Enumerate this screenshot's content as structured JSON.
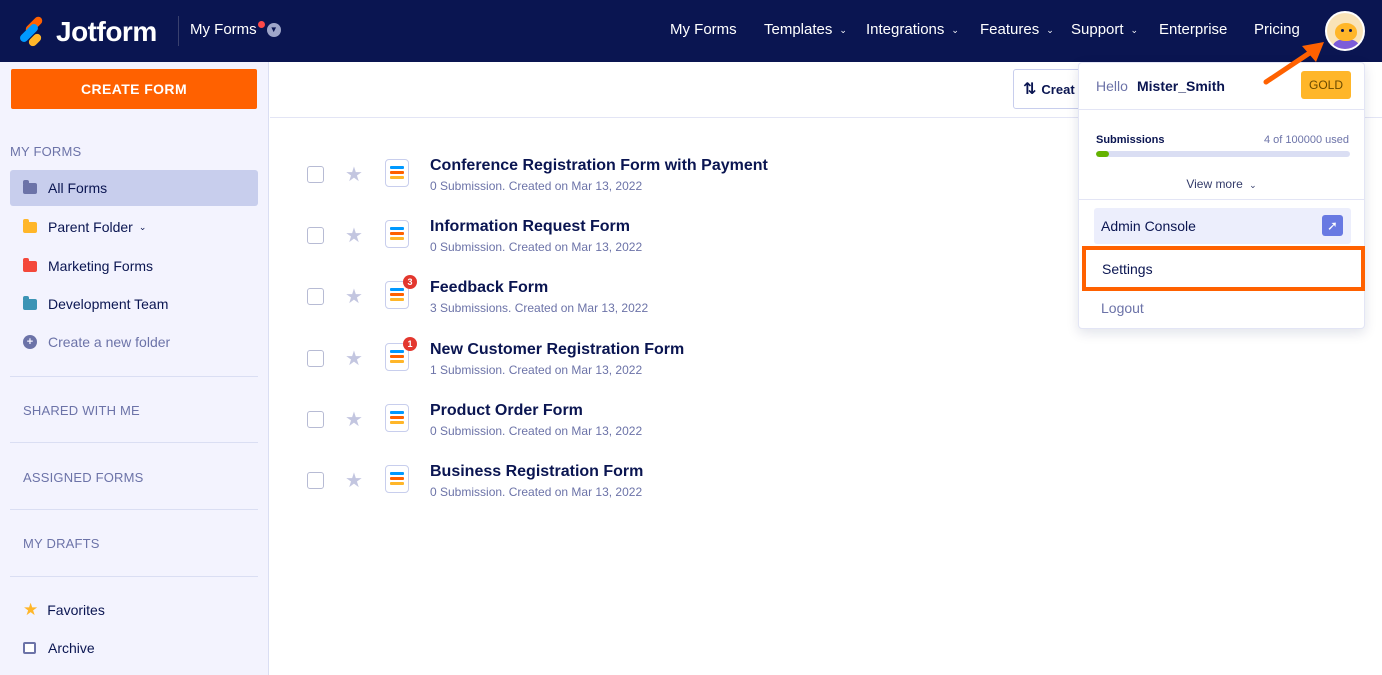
{
  "app": {
    "brand": "Jotform",
    "section": "My Forms"
  },
  "nav": {
    "items": [
      {
        "label": "My Forms",
        "has_menu": false
      },
      {
        "label": "Templates",
        "has_menu": true
      },
      {
        "label": "Integrations",
        "has_menu": true
      },
      {
        "label": "Features",
        "has_menu": true
      },
      {
        "label": "Support",
        "has_menu": true
      },
      {
        "label": "Enterprise",
        "has_menu": false
      },
      {
        "label": "Pricing",
        "has_menu": false
      }
    ]
  },
  "sidebar": {
    "create_label": "CREATE FORM",
    "my_forms_title": "MY FORMS",
    "items": [
      {
        "label": "All Forms",
        "color": "#6c73a8",
        "active": true
      },
      {
        "label": "Parent Folder",
        "color": "#ffb629",
        "has_menu": true
      },
      {
        "label": "Marketing Forms",
        "color": "#f4483b"
      },
      {
        "label": "Development Team",
        "color": "#3c94b5"
      }
    ],
    "create_folder_label": "Create a new folder",
    "shared_title": "SHARED WITH ME",
    "assigned_title": "ASSIGNED FORMS",
    "drafts_title": "MY DRAFTS",
    "favorites_label": "Favorites",
    "archive_label": "Archive"
  },
  "toolbar": {
    "sort_label": "Creat"
  },
  "forms": [
    {
      "title": "Conference Registration Form with Payment",
      "meta": "0 Submission. Created on Mar 13, 2022",
      "badge": ""
    },
    {
      "title": "Information Request Form",
      "meta": "0 Submission. Created on Mar 13, 2022",
      "badge": ""
    },
    {
      "title": "Feedback Form",
      "meta": "3 Submissions. Created on Mar 13, 2022",
      "badge": "3"
    },
    {
      "title": "New Customer Registration Form",
      "meta": "1 Submission. Created on Mar 13, 2022",
      "badge": "1"
    },
    {
      "title": "Product Order Form",
      "meta": "0 Submission. Created on Mar 13, 2022",
      "badge": ""
    },
    {
      "title": "Business Registration Form",
      "meta": "0 Submission. Created on Mar 13, 2022",
      "badge": ""
    }
  ],
  "account_menu": {
    "hello": "Hello",
    "username": "Mister_Smith",
    "plan": "GOLD",
    "submissions_label": "Submissions",
    "usage_text": "4 of 100000 used",
    "usage_fraction": 4e-05,
    "view_more": "View more",
    "admin_console": "Admin Console",
    "settings": "Settings",
    "logout": "Logout"
  },
  "colors": {
    "accent": "#ff6100",
    "navy": "#0a1551"
  }
}
